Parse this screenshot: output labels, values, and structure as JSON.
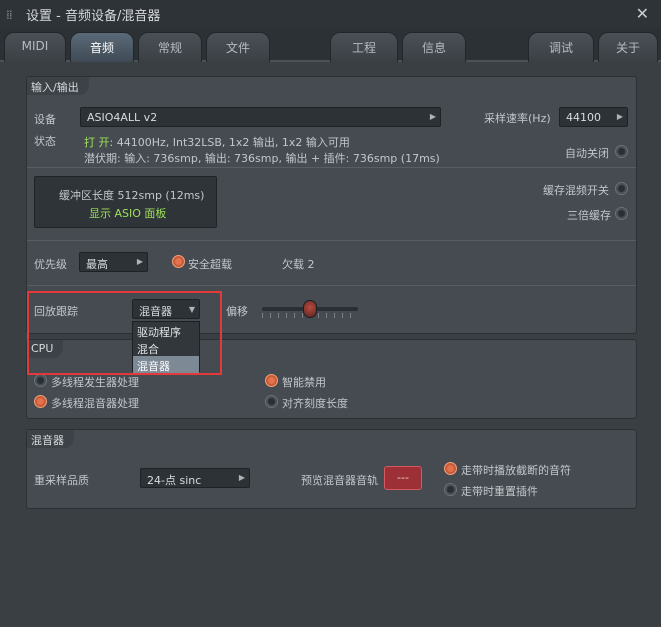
{
  "window": {
    "title": "设置 - 音频设备/混音器",
    "grip_icon": "drag-grip-icon",
    "close_icon": "close-icon"
  },
  "tabs": [
    "MIDI",
    "音频",
    "常规",
    "文件",
    "工程",
    "信息",
    "调试",
    "关于"
  ],
  "active_tab": "音频",
  "io": {
    "title": "输入/输出",
    "device_label": "设备",
    "device_value": "ASIO4ALL v2",
    "samplerate_label": "采样速率(Hz)",
    "samplerate_value": "44100",
    "status_label": "状态",
    "status_open": "打 开",
    "status_line1": ": 44100Hz, Int32LSB, 1x2 输出, 1x2 输入可用",
    "status_line2": "潜伏期: 输入: 736smp, 输出: 736smp, 输出 + 插件: 736smp (17ms)",
    "auto_close_label": "自动关闭",
    "buffer_length": "缓冲区长度 512smp (12ms)",
    "show_asio_panel": "显示 ASIO 面板",
    "buffer_mix_switch_label": "缓存混频开关",
    "triple_buffer_label": "三倍缓存",
    "priority_label": "优先级",
    "priority_value": "最高",
    "safe_overload_label": "安全超载",
    "underrun_text": "欠载 2",
    "playback_tracking_label": "回放跟踪",
    "playback_tracking_value": "混音器",
    "playback_tracking_options": [
      "驱动程序",
      "混合",
      "混音器"
    ],
    "offset_label": "偏移"
  },
  "cpu": {
    "title": "CPU",
    "multithread_generator_label": "多线程发生器处理",
    "multithread_mixer_label": "多线程混音器处理",
    "smart_disable_label": "智能禁用",
    "align_tick_label": "对齐刻度长度"
  },
  "mixer": {
    "title": "混音器",
    "resample_label": "重采样品质",
    "resample_value": "24-点 sinc",
    "preview_track_label": "预览混音器音轨",
    "preview_track_value": "---",
    "play_truncated_label": "走带时播放截断的音符",
    "reset_plugins_label": "走带时重置插件"
  },
  "colors": {
    "accent": "#e2734e",
    "status_green": "#9fe05a",
    "highlight_box": "#e23a3a",
    "track_button": "#9c3036"
  }
}
